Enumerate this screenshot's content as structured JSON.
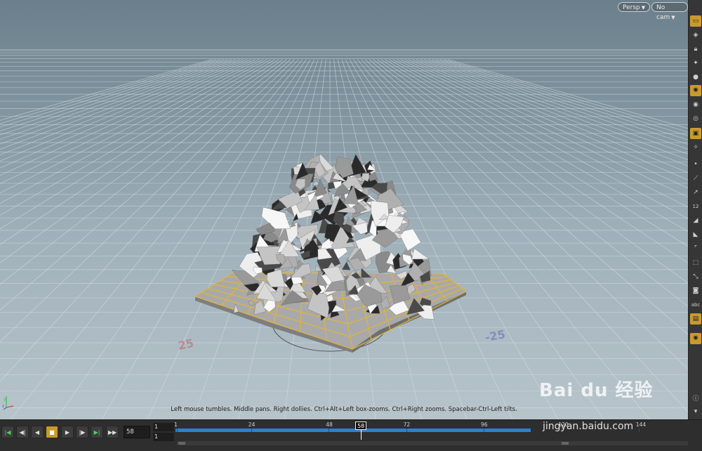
{
  "viewport": {
    "camera_menu": "Persp",
    "cam_menu": "No cam",
    "hint": "Left mouse tumbles. Middle pans. Right dollies. Ctrl+Alt+Left box-zooms. Ctrl+Right zooms. Spacebar-Ctrl-Left tilts.",
    "grid_labels": [
      "25",
      "-25"
    ],
    "axis_labels": [
      "y",
      "z"
    ]
  },
  "shelf": {
    "abc_label": "abc",
    "number_label": "12"
  },
  "playbar": {
    "current_frame": "58",
    "range_start": "1",
    "range_end": "1",
    "timeline_ticks": [
      "1",
      "24",
      "48",
      "72",
      "96",
      "120",
      "144"
    ],
    "current_marker": "58",
    "accent_color": "#c89a2e",
    "timeline_color": "#2f7fd6"
  },
  "watermark": {
    "brand": "Bai du 经验",
    "url": "jingyan.baidu.com"
  }
}
